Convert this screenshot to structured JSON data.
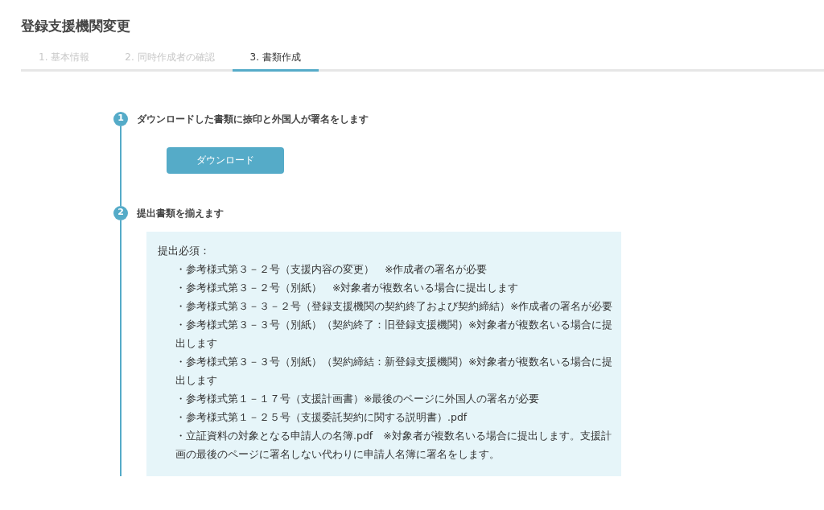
{
  "title": "登録支援機関変更",
  "tabs": [
    {
      "label": "1. 基本情報",
      "selected": false
    },
    {
      "label": "2. 同時作成者の確認",
      "selected": false
    },
    {
      "label": "3. 書類作成",
      "selected": true
    }
  ],
  "steps": [
    {
      "number": "1",
      "text": "ダウンロードした書類に捺印と外国人が署名をします",
      "kind": "button",
      "button": "ダウンロード"
    },
    {
      "number": "2",
      "text": "提出書類を揃えます",
      "kind": "list",
      "heading": "提出必須：",
      "items": [
        "・参考様式第３－２号（支援内容の変更）　※作成者の署名が必要",
        "・参考様式第３－２号（別紙）　※対象者が複数名いる場合に提出します",
        "・参考様式第３－３－２号（登録支援機関の契約終了および契約締結）※作成者の署名が必要",
        "・参考様式第３－３号（別紙）（契約終了：旧登録支援機関）※対象者が複数名いる場合に提出します",
        "・参考様式第３－３号（別紙）（契約締結：新登録支援機関）※対象者が複数名いる場合に提出します",
        "・参考様式第１－１７号（支援計画書）※最後のページに外国人の署名が必要",
        "・参考様式第１－２５号（支援委託契約に関する説明書）.pdf",
        "・立証資料の対象となる申請人の名簿.pdf　※対象者が複数名いる場合に提出します。支援計画の最後のページに署名しない代わりに申請人名簿に署名をします。"
      ]
    }
  ]
}
